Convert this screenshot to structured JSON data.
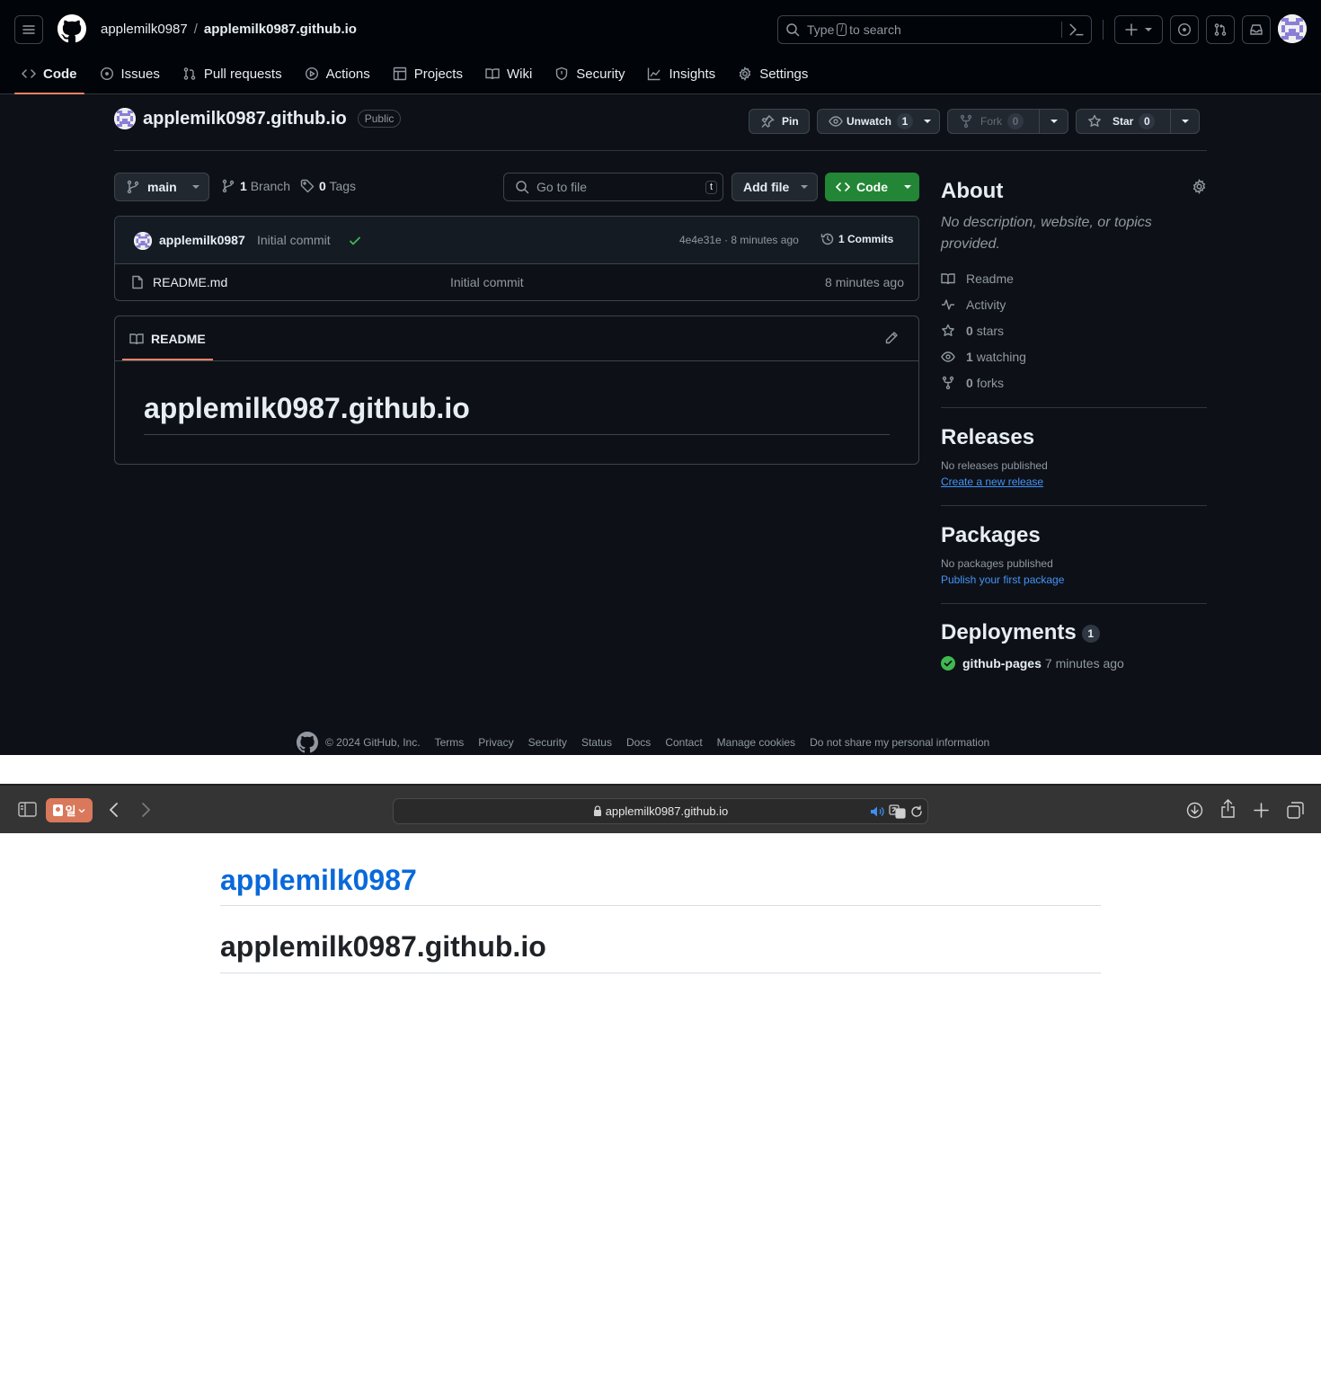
{
  "header": {
    "owner": "applemilk0987",
    "separator": "/",
    "repo": "applemilk0987.github.io",
    "search_prefix": "Type",
    "search_key": "/",
    "search_suffix": "to search"
  },
  "tabs": [
    {
      "label": "Code",
      "icon": "code-icon"
    },
    {
      "label": "Issues",
      "icon": "issue-icon"
    },
    {
      "label": "Pull requests",
      "icon": "pull-request-icon"
    },
    {
      "label": "Actions",
      "icon": "play-icon"
    },
    {
      "label": "Projects",
      "icon": "table-icon"
    },
    {
      "label": "Wiki",
      "icon": "book-icon"
    },
    {
      "label": "Security",
      "icon": "shield-icon"
    },
    {
      "label": "Insights",
      "icon": "graph-icon"
    },
    {
      "label": "Settings",
      "icon": "gear-icon"
    }
  ],
  "repo": {
    "name": "applemilk0987.github.io",
    "visibility": "Public",
    "pin_label": "Pin",
    "unwatch_label": "Unwatch",
    "watch_count": "1",
    "fork_label": "Fork",
    "fork_count": "0",
    "star_label": "Star",
    "star_count": "0"
  },
  "toolbar": {
    "branch": "main",
    "branch_count": "1",
    "branch_label": "Branch",
    "tag_count": "0",
    "tag_label": "Tags",
    "goto_placeholder": "Go to file",
    "goto_key": "t",
    "add_file": "Add file",
    "code": "Code"
  },
  "commit": {
    "author": "applemilk0987",
    "message": "Initial commit",
    "sha": "4e4e31e",
    "dot": "·",
    "time": "8 minutes ago",
    "commits": "1 Commits"
  },
  "files": [
    {
      "name": "README.md",
      "message": "Initial commit",
      "time": "8 minutes ago"
    }
  ],
  "readme": {
    "tab": "README",
    "heading": "applemilk0987.github.io"
  },
  "about": {
    "title": "About",
    "description": "No description, website, or topics provided.",
    "readme": "Readme",
    "activity": "Activity",
    "stars_count": "0",
    "stars_label": "stars",
    "watching_count": "1",
    "watching_label": "watching",
    "forks_count": "0",
    "forks_label": "forks"
  },
  "releases": {
    "title": "Releases",
    "empty": "No releases published",
    "link": "Create a new release"
  },
  "packages": {
    "title": "Packages",
    "empty": "No packages published",
    "link": "Publish your first package"
  },
  "deployments": {
    "title": "Deployments",
    "count": "1",
    "name": "github-pages",
    "time": "7 minutes ago"
  },
  "footer": {
    "copyright": "© 2024 GitHub, Inc.",
    "links": [
      "Terms",
      "Privacy",
      "Security",
      "Status",
      "Docs",
      "Contact",
      "Manage cookies",
      "Do not share my personal information"
    ]
  },
  "browser": {
    "tab_group": "일",
    "url": "applemilk0987.github.io"
  },
  "site": {
    "title": "applemilk0987",
    "heading": "applemilk0987.github.io"
  },
  "colors": {
    "accent": "#f78166",
    "green": "#238636",
    "link": "#4493f8",
    "site_link": "#0969da"
  }
}
